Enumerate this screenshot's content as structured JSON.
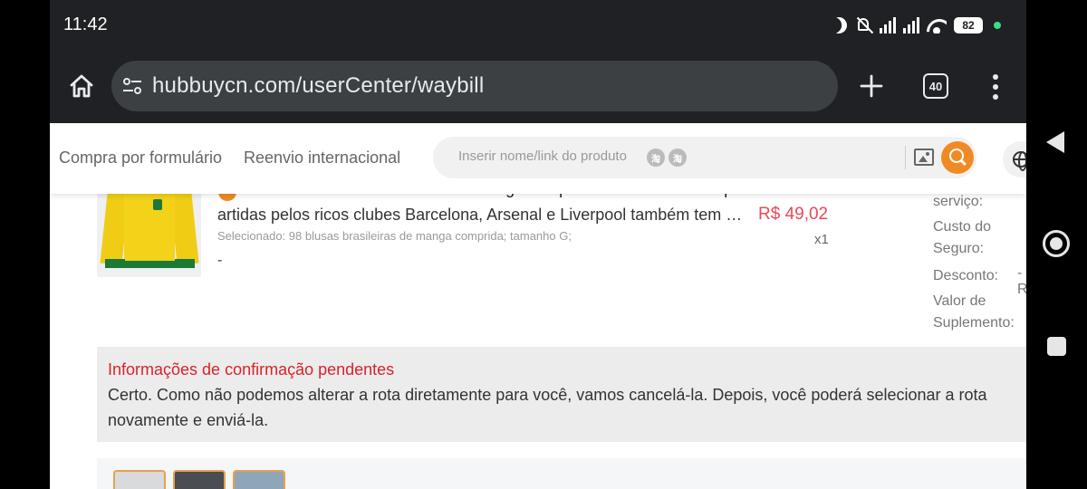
{
  "status_bar": {
    "time": "11:42",
    "battery": "82"
  },
  "browser": {
    "url": "hubbuycn.com/userCenter/waybill",
    "tab_count": "40",
    "icons": [
      "home-icon",
      "site-settings-icon",
      "plus-icon",
      "tabs-icon",
      "more-vert-icon"
    ]
  },
  "site_nav": {
    "link_form": "Compra por formulário",
    "link_resend": "Reenvio internacional",
    "search_placeholder": "Inserir nome/link do produto",
    "badge_1": "淘",
    "badge_2": "淘"
  },
  "product": {
    "title_line1": "O mesmo uniforme de treino de manga comprida usado antes dos p",
    "title_line2": "artidas pelos ricos clubes Barcelona, Arsenal e Liverpool também tem …",
    "selected": "Selecionado: 98 blusas brasileiras de manga comprida; tamanho G;",
    "note": "-",
    "price": "R$ 49,02",
    "quantity": "x1"
  },
  "fees": {
    "service": "serviço:",
    "insurance": "Custo do Seguro:",
    "discount": "Desconto:",
    "discount_value": "-R",
    "supplement": "Valor de Suplemento:"
  },
  "confirmation": {
    "title": "Informações de confirmação pendentes",
    "text": "Certo. Como não podemos alterar a rota diretamente para você, vamos cancelá-la. Depois, você poderá selecionar a rota novamente e enviá-la."
  },
  "colors": {
    "accent": "#f08a24",
    "price": "#e8485a",
    "alert_title": "#d8232a",
    "chrome_bg": "#202124"
  }
}
